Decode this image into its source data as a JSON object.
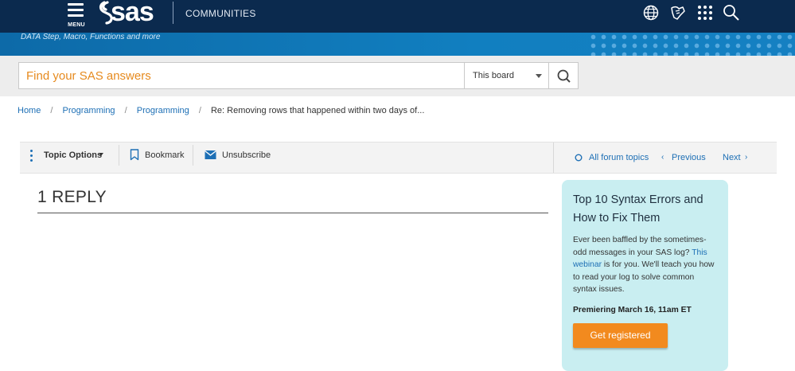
{
  "header": {
    "menu_label": "MENU",
    "logo_text": "sas",
    "section": "COMMUNITIES",
    "icons": [
      "globe-icon",
      "hand-icon",
      "grid-icon",
      "search-icon"
    ]
  },
  "banner": {
    "subtitle": "DATA Step, Macro, Functions and more"
  },
  "search": {
    "placeholder": "Find your SAS answers",
    "scope": "This board"
  },
  "breadcrumb": {
    "home": "Home",
    "level1": "Programming",
    "level2": "Programming",
    "current": "Re: Removing rows that happened within two days of...",
    "separator": "/"
  },
  "topic_bar": {
    "options_label": "Topic Options",
    "bookmark_label": "Bookmark",
    "unsubscribe_label": "Unsubscribe",
    "all_topics_label": "All forum topics",
    "previous_label": "Previous",
    "next_label": "Next"
  },
  "replies": {
    "heading": "1 REPLY"
  },
  "promo": {
    "title": "Top 10 Syntax Errors and How to Fix Them",
    "text_before": "Ever been baffled by the sometimes-odd messages in your SAS log? ",
    "link": "This webinar",
    "text_after": " is for you. We'll teach you how to read your log to solve common syntax issues.",
    "date": "Premiering March 16, 11am ET",
    "cta": "Get registered"
  },
  "colors": {
    "topbar": "#0b2a4e",
    "banner": "#117fc0",
    "link": "#1d6fb5",
    "accent_orange": "#f28a1e",
    "promo_bg": "#c9eef1"
  }
}
